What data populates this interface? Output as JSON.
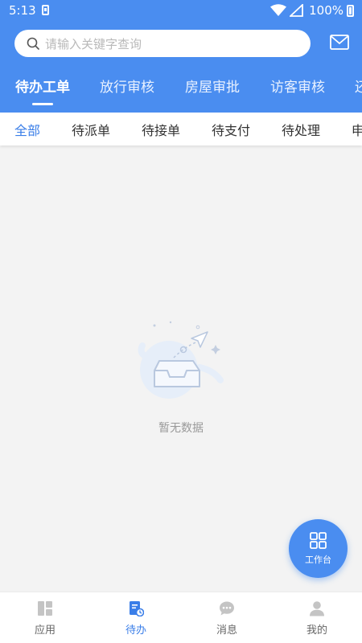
{
  "status_bar": {
    "time": "5:13",
    "battery_percent": "100%"
  },
  "search": {
    "placeholder": "请输入关键字查询"
  },
  "primary_tabs": [
    {
      "label": "待办工单",
      "active": true
    },
    {
      "label": "放行审核",
      "active": false
    },
    {
      "label": "房屋审批",
      "active": false
    },
    {
      "label": "访客审核",
      "active": false
    },
    {
      "label": "还",
      "active": false
    }
  ],
  "secondary_tabs": [
    {
      "label": "全部",
      "active": true
    },
    {
      "label": "待派单",
      "active": false
    },
    {
      "label": "待接单",
      "active": false
    },
    {
      "label": "待支付",
      "active": false
    },
    {
      "label": "待处理",
      "active": false
    },
    {
      "label": "申",
      "active": false
    }
  ],
  "empty_state": {
    "text": "暂无数据",
    "icon": "empty-inbox-illustration"
  },
  "fab": {
    "label": "工作台",
    "icon": "grid-icon"
  },
  "bottom_nav": [
    {
      "label": "应用",
      "icon": "apps-icon",
      "active": false
    },
    {
      "label": "待办",
      "icon": "todo-icon",
      "active": true
    },
    {
      "label": "消息",
      "icon": "message-icon",
      "active": false
    },
    {
      "label": "我的",
      "icon": "profile-icon",
      "active": false
    }
  ],
  "colors": {
    "primary": "#4a8df0",
    "active_text": "#3a7ee8",
    "background": "#f3f3f3"
  }
}
